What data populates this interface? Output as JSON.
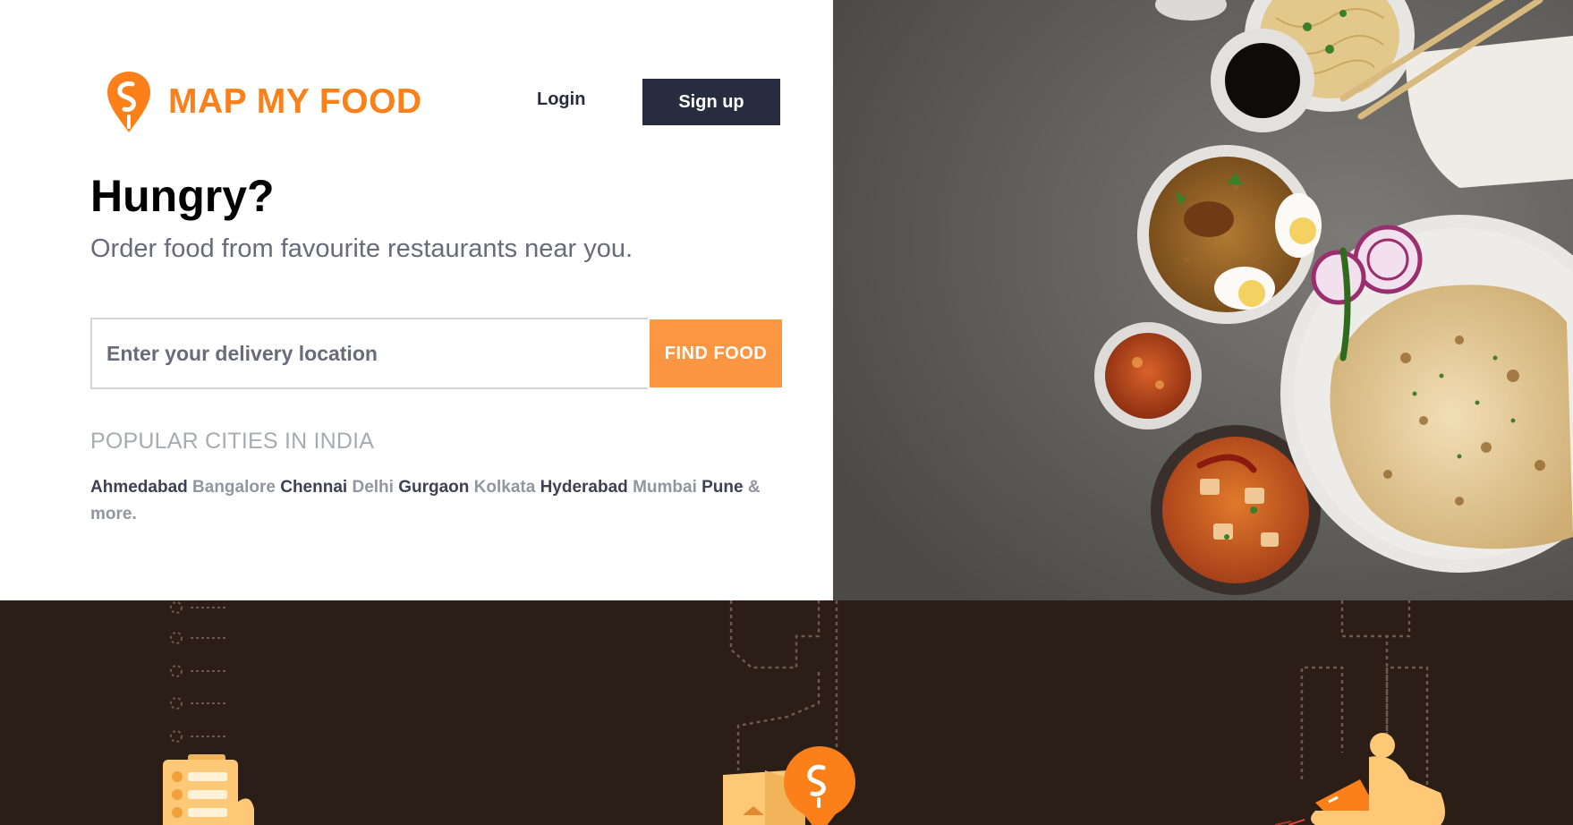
{
  "brand": {
    "name": "MAP MY FOOD",
    "color": "#fc8019",
    "logo_icon": "swiggy-pin-logo"
  },
  "header": {
    "login_label": "Login",
    "signup_label": "Sign up"
  },
  "hero": {
    "headline": "Hungry?",
    "subline": "Order food from favourite restaurants near you."
  },
  "search": {
    "placeholder": "Enter your delivery location",
    "value": "",
    "button_label": "FIND FOOD"
  },
  "popular": {
    "title": "POPULAR CITIES IN INDIA",
    "cities": [
      {
        "name": "Ahmedabad",
        "tone": "dark"
      },
      {
        "name": "Bangalore",
        "tone": "light"
      },
      {
        "name": "Chennai",
        "tone": "dark"
      },
      {
        "name": "Delhi",
        "tone": "light"
      },
      {
        "name": "Gurgaon",
        "tone": "dark"
      },
      {
        "name": "Kolkata",
        "tone": "light"
      },
      {
        "name": "Hyderabad",
        "tone": "dark"
      },
      {
        "name": "Mumbai",
        "tone": "light"
      },
      {
        "name": "Pune",
        "tone": "dark"
      },
      {
        "name": "& more.",
        "tone": "light"
      }
    ]
  },
  "colors": {
    "accent": "#fc8019",
    "dark_button": "#282c3f",
    "bottom_band": "#2b1e16",
    "illustration_yellow": "#ffc877"
  }
}
